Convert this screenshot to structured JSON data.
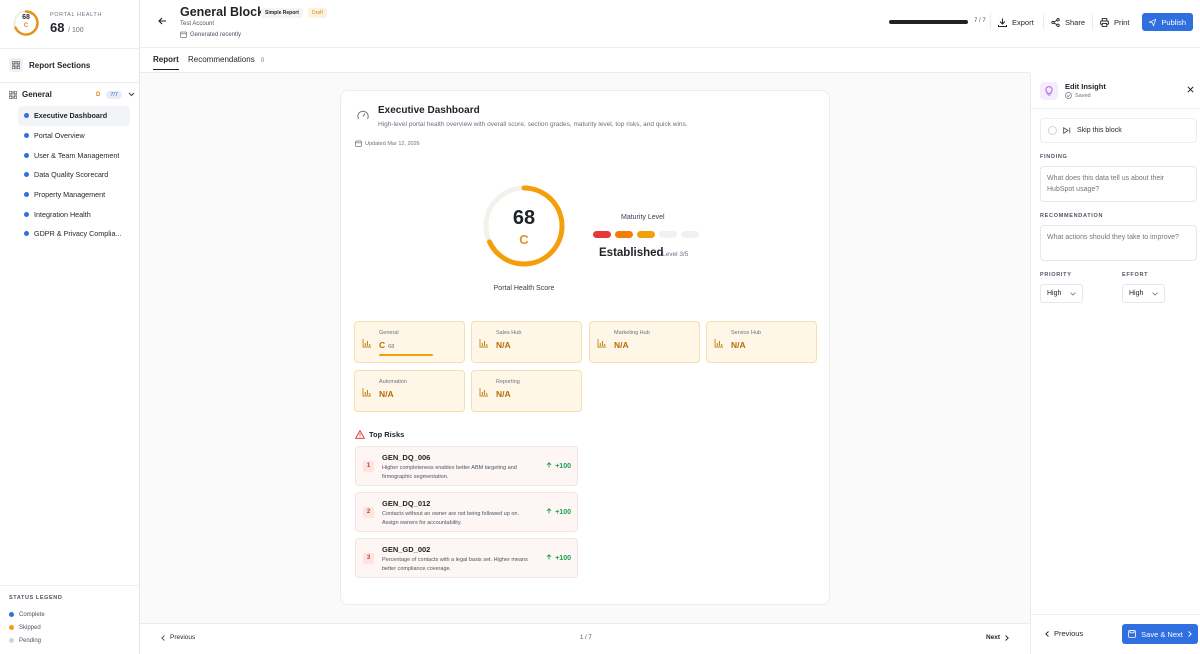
{
  "portal_health": {
    "label": "PORTAL HEALTH",
    "score": "68",
    "grade": "C",
    "denominator": "/ 100",
    "ring_value": 0.68,
    "ring_color": "#e4941d"
  },
  "sidebar": {
    "sections_label": "Report Sections",
    "group": {
      "label": "General",
      "grade": "D",
      "count": "7/7"
    },
    "items": [
      {
        "label": "Executive Dashboard",
        "active": true
      },
      {
        "label": "Portal Overview"
      },
      {
        "label": "User & Team Management"
      },
      {
        "label": "Data Quality Scorecard"
      },
      {
        "label": "Property Management"
      },
      {
        "label": "Integration Health"
      },
      {
        "label": "GDPR & Privacy Complia..."
      }
    ],
    "legend": {
      "title": "STATUS LEGEND",
      "rows": [
        {
          "label": "Complete",
          "color": "#2f6fe0"
        },
        {
          "label": "Skipped",
          "color": "#f59e0b"
        },
        {
          "label": "Pending",
          "color": "#d1d5db"
        }
      ]
    }
  },
  "header": {
    "title": "General Blocks",
    "tag_simple": "Simple Report",
    "tag_draft": "Draft",
    "account": "Test Account",
    "generated": "Generated recently",
    "progress_text": "7 / 7",
    "progress_value": 1.0,
    "export": "Export",
    "share": "Share",
    "print": "Print",
    "publish": "Publish"
  },
  "tabs": {
    "report": "Report",
    "recommendations": "Recommendations",
    "recommendations_count": "0"
  },
  "card": {
    "title": "Executive Dashboard",
    "desc": "High-level portal health overview with overall score, section grades, maturity level, top risks, and quick wins.",
    "updated": "Updated Mar 12, 2026",
    "score": "68",
    "grade": "C",
    "score_caption": "Portal Health Score",
    "score_fraction": 0.68,
    "maturity_label": "Maturity Level",
    "maturity_colors": [
      "#e53935",
      "#f57c00",
      "#f59e0b",
      "#f1f1f1",
      "#f1f1f1"
    ],
    "maturity_value": "Established",
    "maturity_level": "Level 3/5",
    "hubs": [
      {
        "name": "General",
        "grade": "C",
        "score": "68",
        "bar": 0.68
      },
      {
        "name": "Sales Hub",
        "grade": "N/A"
      },
      {
        "name": "Marketing Hub",
        "grade": "N/A"
      },
      {
        "name": "Service Hub",
        "grade": "N/A"
      },
      {
        "name": "Automation",
        "grade": "N/A"
      },
      {
        "name": "Reporting",
        "grade": "N/A"
      }
    ],
    "risks_title": "Top Risks",
    "risks": [
      {
        "num": "1",
        "code": "GEN_DQ_006",
        "desc": "Higher completeness enables better ABM targeting and firmographic segmentation.",
        "impact": "+100"
      },
      {
        "num": "2",
        "code": "GEN_DQ_012",
        "desc": "Contacts without an owner are not being followed up on. Assign owners for accountability.",
        "impact": "+100"
      },
      {
        "num": "3",
        "code": "GEN_GD_002",
        "desc": "Percentage of contacts with a legal basis set. Higher means better compliance coverage.",
        "impact": "+100"
      }
    ]
  },
  "footer": {
    "previous": "Previous",
    "page": "1 / 7",
    "next": "Next"
  },
  "panel": {
    "title": "Edit Insight",
    "saved": "Saved",
    "skip": "Skip this block",
    "finding_label": "FINDING",
    "finding_placeholder": "What does this data tell us about their HubSpot usage?",
    "rec_label": "RECOMMENDATION",
    "rec_placeholder": "What actions should they take to improve?",
    "priority_label": "PRIORITY",
    "priority_value": "High",
    "effort_label": "EFFORT",
    "effort_value": "High",
    "previous": "Previous",
    "save_next": "Save & Next"
  },
  "icons": [
    "back-arrow-icon",
    "download-icon",
    "share-icon",
    "print-icon",
    "send-icon",
    "grid-icon",
    "chevron-down-icon",
    "bar-chart-icon",
    "warning-icon",
    "arrow-up-icon",
    "lightbulb-icon",
    "check-circle-icon",
    "close-icon",
    "skip-icon",
    "calendar-icon",
    "save-icon"
  ]
}
